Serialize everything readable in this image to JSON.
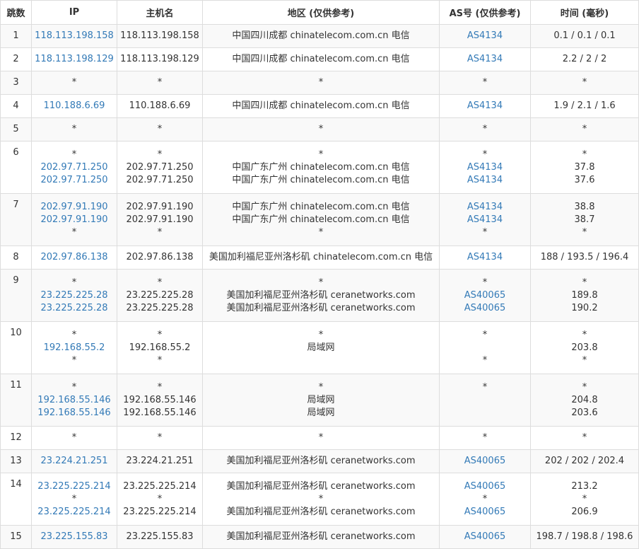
{
  "headers": {
    "hop": "跳数",
    "ip": "IP",
    "host": "主机名",
    "region": "地区 (仅供参考)",
    "as": "AS号 (仅供参考)",
    "time": "时间 (毫秒)"
  },
  "rows": [
    {
      "hop": "1",
      "ip": [
        "118.113.198.158"
      ],
      "host": [
        "118.113.198.158"
      ],
      "region": [
        "中国四川成都 chinatelecom.com.cn 电信"
      ],
      "as": [
        "AS4134"
      ],
      "time": [
        "0.1 / 0.1 / 0.1"
      ]
    },
    {
      "hop": "2",
      "ip": [
        "118.113.198.129"
      ],
      "host": [
        "118.113.198.129"
      ],
      "region": [
        "中国四川成都 chinatelecom.com.cn 电信"
      ],
      "as": [
        "AS4134"
      ],
      "time": [
        "2.2 / 2 / 2"
      ]
    },
    {
      "hop": "3",
      "ip": [
        "*"
      ],
      "host": [
        "*"
      ],
      "region": [
        "*"
      ],
      "as": [
        "*"
      ],
      "time": [
        "*"
      ]
    },
    {
      "hop": "4",
      "ip": [
        "110.188.6.69"
      ],
      "host": [
        "110.188.6.69"
      ],
      "region": [
        "中国四川成都 chinatelecom.com.cn 电信"
      ],
      "as": [
        "AS4134"
      ],
      "time": [
        "1.9 / 2.1 / 1.6"
      ]
    },
    {
      "hop": "5",
      "ip": [
        "*"
      ],
      "host": [
        "*"
      ],
      "region": [
        "*"
      ],
      "as": [
        "*"
      ],
      "time": [
        "*"
      ]
    },
    {
      "hop": "6",
      "ip": [
        "*",
        "202.97.71.250",
        "202.97.71.250"
      ],
      "host": [
        "*",
        "202.97.71.250",
        "202.97.71.250"
      ],
      "region": [
        "*",
        "中国广东广州 chinatelecom.com.cn 电信",
        "中国广东广州 chinatelecom.com.cn 电信"
      ],
      "as": [
        "*",
        "AS4134",
        "AS4134"
      ],
      "time": [
        "*",
        "37.8",
        "37.6"
      ]
    },
    {
      "hop": "7",
      "ip": [
        "202.97.91.190",
        "202.97.91.190",
        "*"
      ],
      "host": [
        "202.97.91.190",
        "202.97.91.190",
        "*"
      ],
      "region": [
        "中国广东广州 chinatelecom.com.cn 电信",
        "中国广东广州 chinatelecom.com.cn 电信",
        "*"
      ],
      "as": [
        "AS4134",
        "AS4134",
        "*"
      ],
      "time": [
        "38.8",
        "38.7",
        "*"
      ]
    },
    {
      "hop": "8",
      "ip": [
        "202.97.86.138"
      ],
      "host": [
        "202.97.86.138"
      ],
      "region": [
        "美国加利福尼亚州洛杉矶 chinatelecom.com.cn 电信"
      ],
      "as": [
        "AS4134"
      ],
      "time": [
        "188 / 193.5 / 196.4"
      ]
    },
    {
      "hop": "9",
      "ip": [
        "*",
        "23.225.225.28",
        "23.225.225.28"
      ],
      "host": [
        "*",
        "23.225.225.28",
        "23.225.225.28"
      ],
      "region": [
        "*",
        "美国加利福尼亚州洛杉矶 ceranetworks.com",
        "美国加利福尼亚州洛杉矶 ceranetworks.com"
      ],
      "as": [
        "*",
        "AS40065",
        "AS40065"
      ],
      "time": [
        "*",
        "189.8",
        "190.2"
      ]
    },
    {
      "hop": "10",
      "ip": [
        "*",
        "192.168.55.2",
        "*"
      ],
      "host": [
        "*",
        "192.168.55.2",
        "*"
      ],
      "region": [
        "*",
        "局域网",
        ""
      ],
      "as": [
        "*",
        "",
        "*"
      ],
      "time": [
        "*",
        "203.8",
        "*"
      ]
    },
    {
      "hop": "11",
      "ip": [
        "*",
        "192.168.55.146",
        "192.168.55.146"
      ],
      "host": [
        "*",
        "192.168.55.146",
        "192.168.55.146"
      ],
      "region": [
        "*",
        "局域网",
        "局域网"
      ],
      "as": [
        "*",
        "",
        ""
      ],
      "time": [
        "*",
        "204.8",
        "203.6"
      ]
    },
    {
      "hop": "12",
      "ip": [
        "*"
      ],
      "host": [
        "*"
      ],
      "region": [
        "*"
      ],
      "as": [
        "*"
      ],
      "time": [
        "*"
      ]
    },
    {
      "hop": "13",
      "ip": [
        "23.224.21.251"
      ],
      "host": [
        "23.224.21.251"
      ],
      "region": [
        "美国加利福尼亚州洛杉矶 ceranetworks.com"
      ],
      "as": [
        "AS40065"
      ],
      "time": [
        "202 / 202 / 202.4"
      ]
    },
    {
      "hop": "14",
      "ip": [
        "23.225.225.214",
        "*",
        "23.225.225.214"
      ],
      "host": [
        "23.225.225.214",
        "*",
        "23.225.225.214"
      ],
      "region": [
        "美国加利福尼亚州洛杉矶 ceranetworks.com",
        "*",
        "美国加利福尼亚州洛杉矶 ceranetworks.com"
      ],
      "as": [
        "AS40065",
        "*",
        "AS40065"
      ],
      "time": [
        "213.2",
        "*",
        "206.9"
      ]
    },
    {
      "hop": "15",
      "ip": [
        "23.225.155.83"
      ],
      "host": [
        "23.225.155.83"
      ],
      "region": [
        "美国加利福尼亚州洛杉矶 ceranetworks.com"
      ],
      "as": [
        "AS40065"
      ],
      "time": [
        "198.7 / 198.8 / 198.6"
      ]
    }
  ]
}
